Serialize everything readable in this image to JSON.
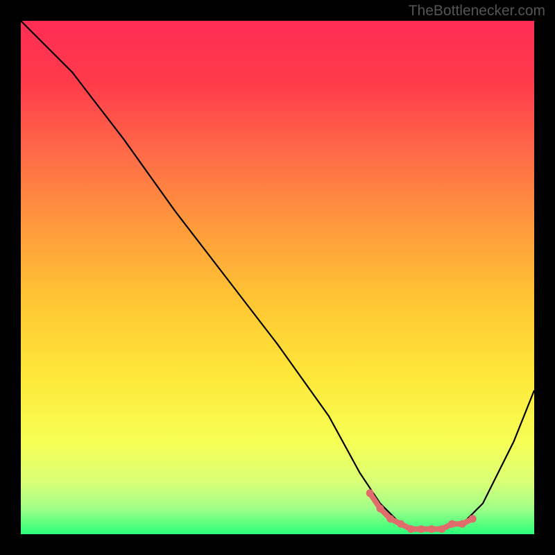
{
  "watermark": "TheBottlenecker.com",
  "chart_data": {
    "type": "line",
    "title": "",
    "xlabel": "",
    "ylabel": "",
    "xlim": [
      0,
      100
    ],
    "ylim": [
      0,
      100
    ],
    "background_gradient": {
      "type": "vertical_rainbow",
      "stops": [
        {
          "offset": 0.0,
          "color": "#ff2d55"
        },
        {
          "offset": 0.12,
          "color": "#ff3b4a"
        },
        {
          "offset": 0.25,
          "color": "#ff6848"
        },
        {
          "offset": 0.4,
          "color": "#ff9a3c"
        },
        {
          "offset": 0.55,
          "color": "#ffc733"
        },
        {
          "offset": 0.7,
          "color": "#fde93a"
        },
        {
          "offset": 0.82,
          "color": "#f7ff55"
        },
        {
          "offset": 0.9,
          "color": "#d8ff77"
        },
        {
          "offset": 0.95,
          "color": "#a0ff88"
        },
        {
          "offset": 1.0,
          "color": "#2aff7a"
        }
      ]
    },
    "series": [
      {
        "name": "bottleneck_curve",
        "color": "#000000",
        "x": [
          0,
          4,
          10,
          20,
          30,
          40,
          50,
          60,
          66,
          70,
          74,
          78,
          82,
          86,
          90,
          96,
          100
        ],
        "y": [
          100,
          96,
          90,
          77,
          63,
          50,
          37,
          23,
          12,
          6,
          2,
          1,
          1,
          2,
          6,
          18,
          28
        ]
      }
    ],
    "marker_segment": {
      "name": "optimal_range_markers",
      "color": "#e06c6c",
      "x": [
        68,
        70,
        72,
        74,
        76,
        78,
        80,
        82,
        84,
        86,
        88
      ],
      "y": [
        8,
        5,
        3,
        2,
        1,
        1,
        1,
        1,
        2,
        2,
        3
      ]
    }
  }
}
